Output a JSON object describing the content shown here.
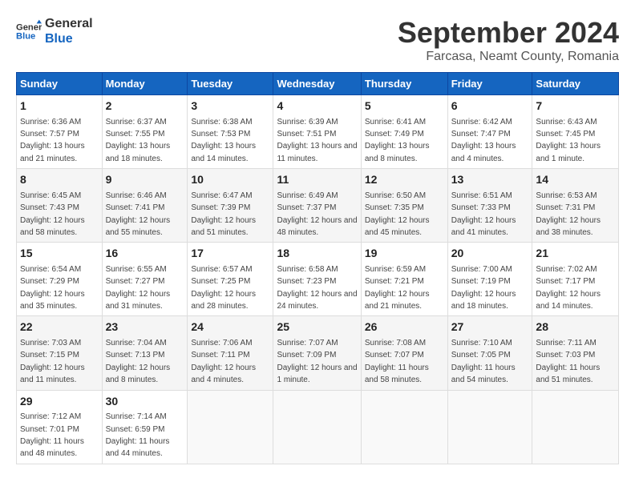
{
  "logo": {
    "line1": "General",
    "line2": "Blue"
  },
  "title": "September 2024",
  "location": "Farcasa, Neamt County, Romania",
  "headers": [
    "Sunday",
    "Monday",
    "Tuesday",
    "Wednesday",
    "Thursday",
    "Friday",
    "Saturday"
  ],
  "weeks": [
    [
      {
        "day": "1",
        "sunrise": "6:36 AM",
        "sunset": "7:57 PM",
        "daylight": "13 hours and 21 minutes."
      },
      {
        "day": "2",
        "sunrise": "6:37 AM",
        "sunset": "7:55 PM",
        "daylight": "13 hours and 18 minutes."
      },
      {
        "day": "3",
        "sunrise": "6:38 AM",
        "sunset": "7:53 PM",
        "daylight": "13 hours and 14 minutes."
      },
      {
        "day": "4",
        "sunrise": "6:39 AM",
        "sunset": "7:51 PM",
        "daylight": "13 hours and 11 minutes."
      },
      {
        "day": "5",
        "sunrise": "6:41 AM",
        "sunset": "7:49 PM",
        "daylight": "13 hours and 8 minutes."
      },
      {
        "day": "6",
        "sunrise": "6:42 AM",
        "sunset": "7:47 PM",
        "daylight": "13 hours and 4 minutes."
      },
      {
        "day": "7",
        "sunrise": "6:43 AM",
        "sunset": "7:45 PM",
        "daylight": "13 hours and 1 minute."
      }
    ],
    [
      {
        "day": "8",
        "sunrise": "6:45 AM",
        "sunset": "7:43 PM",
        "daylight": "12 hours and 58 minutes."
      },
      {
        "day": "9",
        "sunrise": "6:46 AM",
        "sunset": "7:41 PM",
        "daylight": "12 hours and 55 minutes."
      },
      {
        "day": "10",
        "sunrise": "6:47 AM",
        "sunset": "7:39 PM",
        "daylight": "12 hours and 51 minutes."
      },
      {
        "day": "11",
        "sunrise": "6:49 AM",
        "sunset": "7:37 PM",
        "daylight": "12 hours and 48 minutes."
      },
      {
        "day": "12",
        "sunrise": "6:50 AM",
        "sunset": "7:35 PM",
        "daylight": "12 hours and 45 minutes."
      },
      {
        "day": "13",
        "sunrise": "6:51 AM",
        "sunset": "7:33 PM",
        "daylight": "12 hours and 41 minutes."
      },
      {
        "day": "14",
        "sunrise": "6:53 AM",
        "sunset": "7:31 PM",
        "daylight": "12 hours and 38 minutes."
      }
    ],
    [
      {
        "day": "15",
        "sunrise": "6:54 AM",
        "sunset": "7:29 PM",
        "daylight": "12 hours and 35 minutes."
      },
      {
        "day": "16",
        "sunrise": "6:55 AM",
        "sunset": "7:27 PM",
        "daylight": "12 hours and 31 minutes."
      },
      {
        "day": "17",
        "sunrise": "6:57 AM",
        "sunset": "7:25 PM",
        "daylight": "12 hours and 28 minutes."
      },
      {
        "day": "18",
        "sunrise": "6:58 AM",
        "sunset": "7:23 PM",
        "daylight": "12 hours and 24 minutes."
      },
      {
        "day": "19",
        "sunrise": "6:59 AM",
        "sunset": "7:21 PM",
        "daylight": "12 hours and 21 minutes."
      },
      {
        "day": "20",
        "sunrise": "7:00 AM",
        "sunset": "7:19 PM",
        "daylight": "12 hours and 18 minutes."
      },
      {
        "day": "21",
        "sunrise": "7:02 AM",
        "sunset": "7:17 PM",
        "daylight": "12 hours and 14 minutes."
      }
    ],
    [
      {
        "day": "22",
        "sunrise": "7:03 AM",
        "sunset": "7:15 PM",
        "daylight": "12 hours and 11 minutes."
      },
      {
        "day": "23",
        "sunrise": "7:04 AM",
        "sunset": "7:13 PM",
        "daylight": "12 hours and 8 minutes."
      },
      {
        "day": "24",
        "sunrise": "7:06 AM",
        "sunset": "7:11 PM",
        "daylight": "12 hours and 4 minutes."
      },
      {
        "day": "25",
        "sunrise": "7:07 AM",
        "sunset": "7:09 PM",
        "daylight": "12 hours and 1 minute."
      },
      {
        "day": "26",
        "sunrise": "7:08 AM",
        "sunset": "7:07 PM",
        "daylight": "11 hours and 58 minutes."
      },
      {
        "day": "27",
        "sunrise": "7:10 AM",
        "sunset": "7:05 PM",
        "daylight": "11 hours and 54 minutes."
      },
      {
        "day": "28",
        "sunrise": "7:11 AM",
        "sunset": "7:03 PM",
        "daylight": "11 hours and 51 minutes."
      }
    ],
    [
      {
        "day": "29",
        "sunrise": "7:12 AM",
        "sunset": "7:01 PM",
        "daylight": "11 hours and 48 minutes."
      },
      {
        "day": "30",
        "sunrise": "7:14 AM",
        "sunset": "6:59 PM",
        "daylight": "11 hours and 44 minutes."
      },
      null,
      null,
      null,
      null,
      null
    ]
  ]
}
